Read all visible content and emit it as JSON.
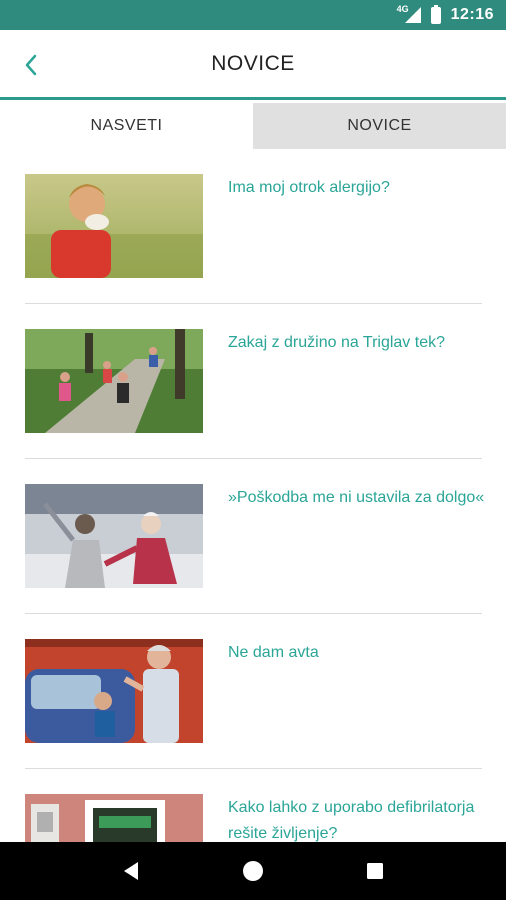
{
  "status_bar": {
    "time": "12:16",
    "network": "4G"
  },
  "app_bar": {
    "title": "NOVICE"
  },
  "tabs": [
    {
      "label": "NASVETI",
      "active": true
    },
    {
      "label": "NOVICE",
      "active": false
    }
  ],
  "articles": [
    {
      "title": "Ima moj otrok alergijo?"
    },
    {
      "title": "Zakaj z družino na Triglav tek?"
    },
    {
      "title": "»Poškodba me ni ustavila za dolgo«"
    },
    {
      "title": "Ne dam avta"
    },
    {
      "title": "Kako lahko z uporabo defibrilatorja rešite življenje?"
    }
  ],
  "colors": {
    "accent": "#2aa597",
    "status_bar": "#2e8b7d"
  },
  "icons": {
    "back": "back-arrow-icon",
    "nav_back": "triangle-back-icon",
    "nav_home": "circle-home-icon",
    "nav_recents": "square-recents-icon"
  }
}
